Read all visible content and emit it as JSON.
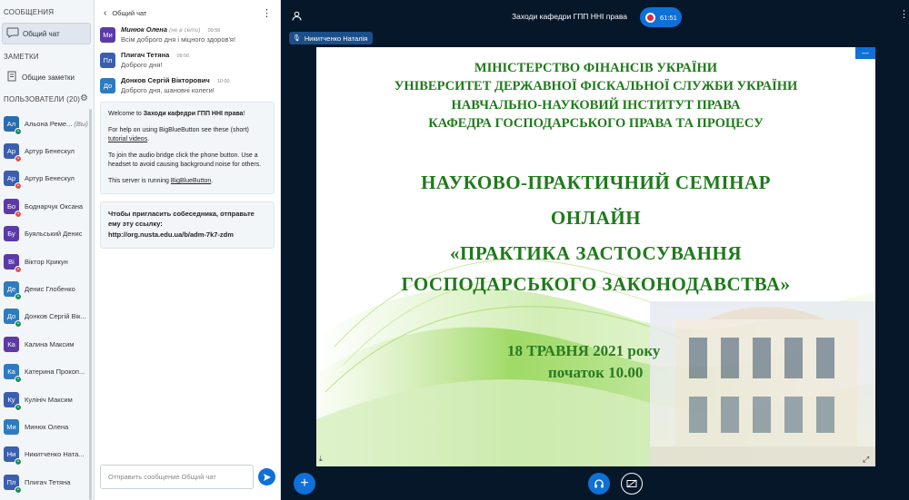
{
  "sidebar": {
    "messages_title": "СООБЩЕНИЯ",
    "public_chat": "Общий чат",
    "notes_title": "ЗАМЕТКИ",
    "shared_notes": "Общие заметки",
    "users_title": "ПОЛЬЗОВАТЕЛИ (20)",
    "users": [
      {
        "initials": "Ал",
        "name": "Альона Реме...",
        "suffix": "(Вы)",
        "color": "#2b6cb0",
        "mic": "#1b8a5a"
      },
      {
        "initials": "Ар",
        "name": "Артур Бенескул",
        "suffix": "",
        "color": "#3a5fb0",
        "mic": "#d9534f"
      },
      {
        "initials": "Ар",
        "name": "Артур Бенескул",
        "suffix": "",
        "color": "#3a5fb0",
        "mic": "#d9534f"
      },
      {
        "initials": "Бо",
        "name": "Боднарчук Оксана",
        "suffix": "",
        "color": "#5b3aa8",
        "mic": "#d9534f"
      },
      {
        "initials": "Бу",
        "name": "Буяльський Денис",
        "suffix": "",
        "color": "#5b3aa8",
        "mic": ""
      },
      {
        "initials": "Ві",
        "name": "Віктор Крикун",
        "suffix": "",
        "color": "#5b3aa8",
        "mic": "#d9534f"
      },
      {
        "initials": "Де",
        "name": "Денис Глобенко",
        "suffix": "",
        "color": "#2e7bbf",
        "mic": "#1b8a5a"
      },
      {
        "initials": "До",
        "name": "Донков Сергій Вік...",
        "suffix": "",
        "color": "#2e7bbf",
        "mic": "#1b8a5a"
      },
      {
        "initials": "Ка",
        "name": "Калина Максим",
        "suffix": "",
        "color": "#5b3aa8",
        "mic": ""
      },
      {
        "initials": "Ка",
        "name": "Катерина Прокоп...",
        "suffix": "",
        "color": "#2e7bbf",
        "mic": "#1b8a5a"
      },
      {
        "initials": "Ку",
        "name": "Кулініч Максим",
        "suffix": "",
        "color": "#3a5fb0",
        "mic": "#1b8a5a"
      },
      {
        "initials": "Ми",
        "name": "Минюк Олена",
        "suffix": "",
        "color": "#2e7bbf",
        "mic": ""
      },
      {
        "initials": "Ни",
        "name": "Никитченко Ната...",
        "suffix": "",
        "color": "#3a5fb0",
        "mic": "#1b8a5a"
      },
      {
        "initials": "Пл",
        "name": "Плигач Тетяна",
        "suffix": "",
        "color": "#3a5fb0",
        "mic": "#1b8a5a"
      }
    ]
  },
  "chat": {
    "back_label": "Общий чат",
    "messages": [
      {
        "initials": "Ми",
        "color": "#5b3aa8",
        "name": "Минюк Олена",
        "offline": "(не в сети)",
        "time": "09:56",
        "text": "Всім доброго дня і міцного здоров'я!"
      },
      {
        "initials": "Пл",
        "color": "#3a5fb0",
        "name": "Плигач Тетяна",
        "offline": "",
        "time": "09:56",
        "text": "Доброго дня!"
      },
      {
        "initials": "До",
        "color": "#2e7bbf",
        "name": "Донков Сергій Вікторович",
        "offline": "",
        "time": "10:00",
        "text": "Доброго дня, шановні колеги!"
      }
    ],
    "welcome": {
      "line1_prefix": "Welcome to",
      "line1_bold": "Заходи кафедри ГПП ННІ права",
      "line1_suffix": "!",
      "line2_prefix": "For help on using BigBlueButton see these (short)",
      "line2_link": "tutorial videos",
      "line2_suffix": ".",
      "line3": "To join the audio bridge click the phone button. Use a headset to avoid causing background noise for others.",
      "line4_prefix": "This server is running",
      "line4_link": "BigBlueButton",
      "line4_suffix": "."
    },
    "invite": {
      "text": "Чтобы пригласить собеседника, отправьте ему эту ссылку:",
      "link": "http://org.nusta.edu.ua/b/adm-7k7-zdm"
    },
    "input_placeholder": "Отправить сообщение Общий чат"
  },
  "stage": {
    "meeting_title": "Заходи кафедри ГПП ННІ права",
    "recording_time": "61:51",
    "talker": "Никитченко Наталія"
  },
  "slide": {
    "header_lines": [
      "МІНІСТЕРСТВО ФІНАНСІВ  УКРАЇНИ",
      "УНІВЕРСИТЕТ ДЕРЖАВНОЇ ФІСКАЛЬНОЇ СЛУЖБИ УКРАЇНИ",
      "НАВЧАЛЬНО-НАУКОВИЙ ІНСТИТУТ ПРАВА",
      "КАФЕДРА ГОСПОДАРСЬКОГО ПРАВА ТА ПРОЦЕСУ"
    ],
    "big_lines": [
      "НАУКОВО-ПРАКТИЧНИЙ СЕМІНАР",
      "ОНЛАЙН",
      "«ПРАКТИКА ЗАСТОСУВАННЯ",
      "ГОСПОДАРСЬКОГО ЗАКОНОДАВСТВА»"
    ],
    "date": "18 ТРАВНЯ 2021 року",
    "start": "початок  10.00"
  },
  "icons": {
    "back": "chevron-left-icon",
    "gear": "gear-icon",
    "plus": "plus-icon",
    "headset": "headset-icon",
    "screen": "screen-share-off-icon",
    "download": "download-icon",
    "fullscreen": "fullscreen-icon"
  },
  "colors": {
    "accent": "#0f70d7",
    "stage_bg": "#06172a",
    "slide_text": "#1e7a1a"
  }
}
